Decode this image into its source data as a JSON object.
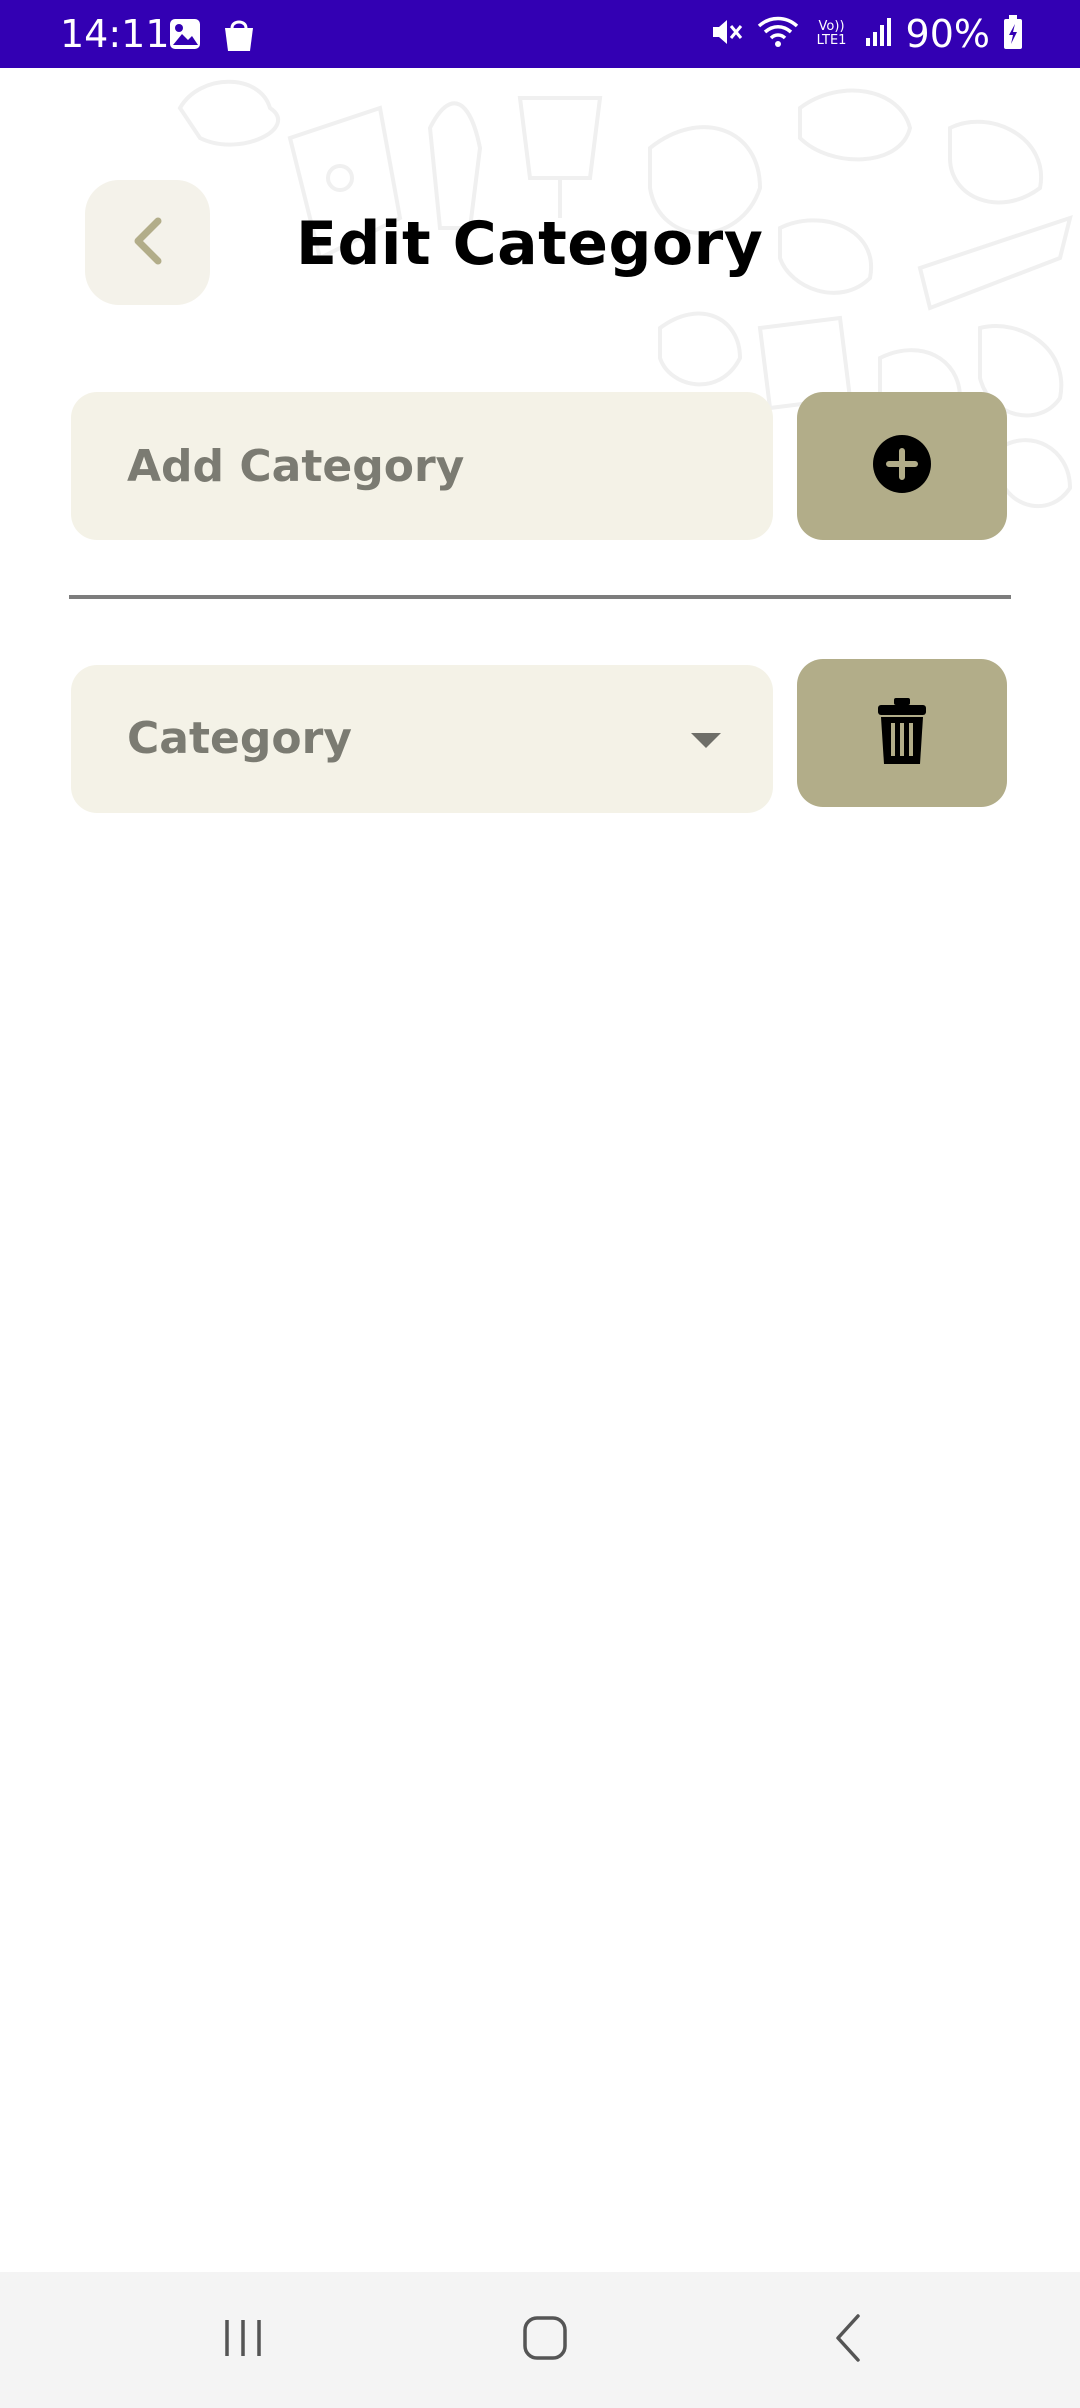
{
  "status_bar": {
    "time": "14:11",
    "battery_percent": "90%",
    "icons": [
      "gallery-icon",
      "shopping-bag-icon",
      "mute-icon",
      "wifi-icon",
      "volte-icon",
      "signal-icon",
      "battery-charging-icon"
    ],
    "volte_label": "Vo)) LTE1",
    "background_color": "#3300b3"
  },
  "header": {
    "title": "Edit Category",
    "back_icon": "chevron-left-icon"
  },
  "add_category": {
    "placeholder": "Add Category",
    "value": "",
    "button_icon": "plus-circle-icon"
  },
  "category_selector": {
    "label": "Category",
    "icon": "dropdown-arrow-icon",
    "delete_icon": "trash-icon"
  },
  "navigation_bar": {
    "items": [
      "recent-apps-icon",
      "home-icon",
      "back-icon"
    ]
  },
  "colors": {
    "field_background": "#f4f2e7",
    "button_background": "#b2ad89",
    "text_muted": "#7b7b72",
    "accent_back": "#b2ad89"
  }
}
